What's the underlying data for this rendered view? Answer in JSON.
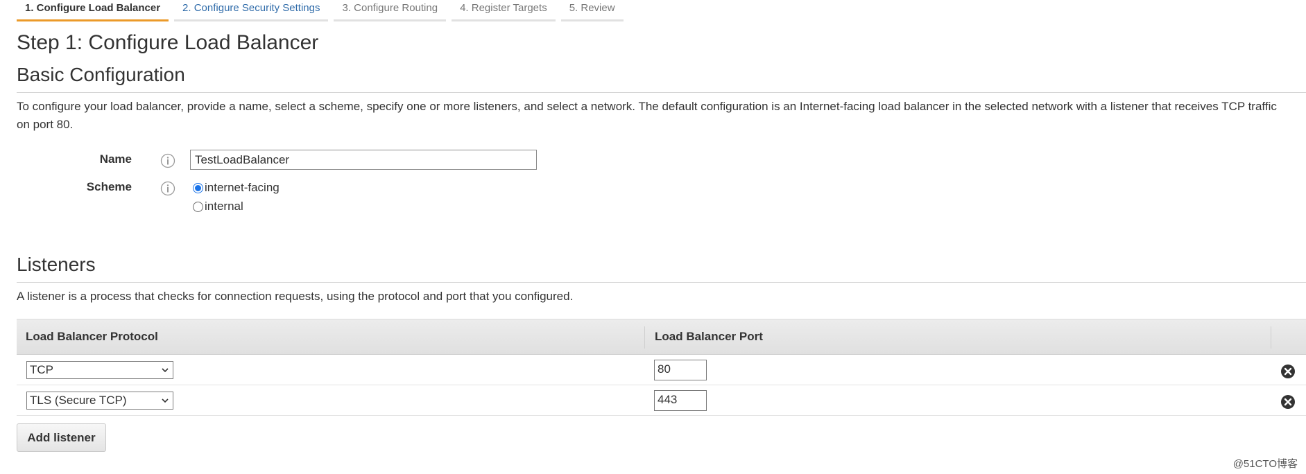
{
  "wizard": {
    "steps": [
      {
        "label": "1. Configure Load Balancer"
      },
      {
        "label": "2. Configure Security Settings"
      },
      {
        "label": "3. Configure Routing"
      },
      {
        "label": "4. Register Targets"
      },
      {
        "label": "5. Review"
      }
    ]
  },
  "page_title": "Step 1: Configure Load Balancer",
  "basic": {
    "title": "Basic Configuration",
    "description": "To configure your load balancer, provide a name, select a scheme, specify one or more listeners, and select a network. The default configuration is an Internet-facing load balancer in the selected network with a listener that receives TCP traffic on port 80.",
    "name_label": "Name",
    "name_value": "TestLoadBalancer",
    "scheme_label": "Scheme",
    "scheme_options": [
      {
        "label": "internet-facing",
        "checked": true
      },
      {
        "label": "internal",
        "checked": false
      }
    ]
  },
  "listeners": {
    "title": "Listeners",
    "description": "A listener is a process that checks for connection requests, using the protocol and port that you configured.",
    "columns": [
      "Load Balancer Protocol",
      "Load Balancer Port"
    ],
    "rows": [
      {
        "protocol": "TCP",
        "port": "80"
      },
      {
        "protocol": "TLS (Secure TCP)",
        "port": "443"
      }
    ],
    "add_button": "Add listener"
  },
  "watermark": "@51CTO博客",
  "colors": {
    "accent": "#eb9a29",
    "link": "#2f6ba9",
    "radio": "#1a73e8"
  },
  "icons": {
    "info": "info-icon",
    "remove": "remove-circle-icon",
    "dropdown": "chevron-down-icon"
  }
}
